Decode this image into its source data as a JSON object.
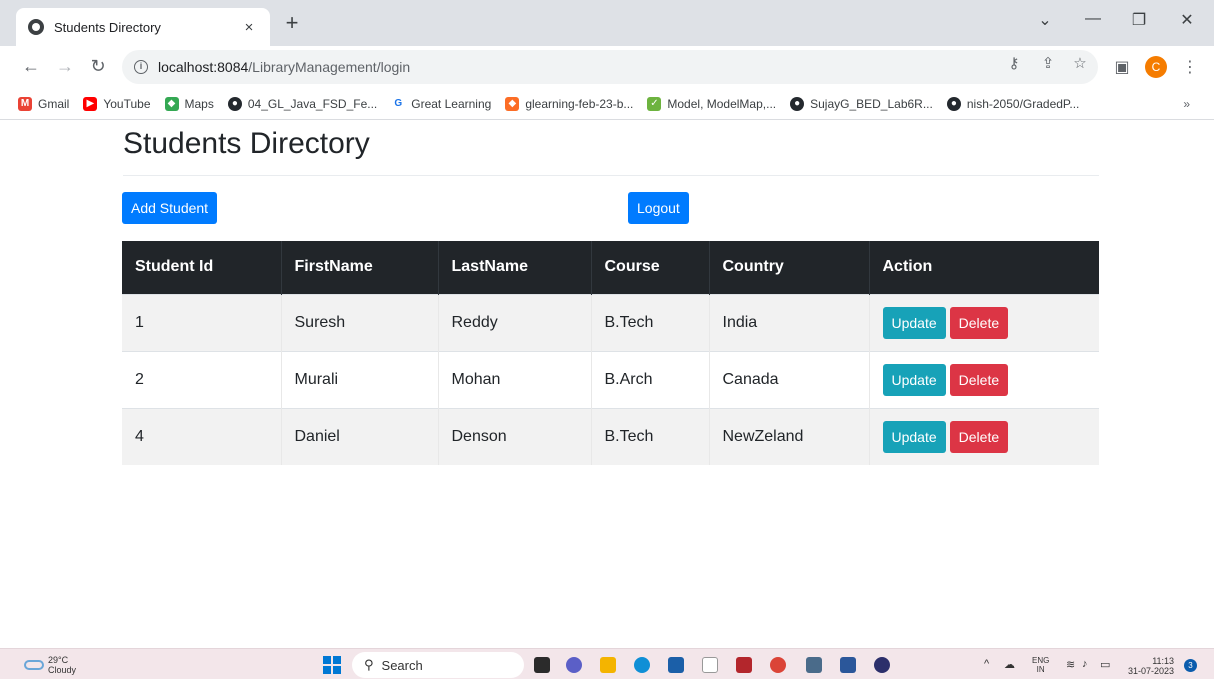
{
  "browser": {
    "tab_title": "Students Directory",
    "tab_close": "×",
    "new_tab": "+",
    "url_host": "localhost:8084",
    "url_path": "/LibraryManagement/login",
    "avatar_letter": "C",
    "bookmarks": [
      {
        "label": "Gmail",
        "icon": "gmail-icon",
        "color": "#ea4335"
      },
      {
        "label": "YouTube",
        "icon": "youtube-icon",
        "color": "#ff0000"
      },
      {
        "label": "Maps",
        "icon": "maps-icon",
        "color": "#34a853"
      },
      {
        "label": "04_GL_Java_FSD_Fe...",
        "icon": "github-icon",
        "color": "#24292e"
      },
      {
        "label": "Great Learning",
        "icon": "great-learning-icon",
        "color": "#1a73e8"
      },
      {
        "label": "glearning-feb-23-b...",
        "icon": "gitlab-icon",
        "color": "#fc6d26"
      },
      {
        "label": "Model, ModelMap,...",
        "icon": "spring-icon",
        "color": "#6db33f"
      },
      {
        "label": "SujayG_BED_Lab6R...",
        "icon": "github-icon",
        "color": "#24292e"
      },
      {
        "label": "nish-2050/GradedP...",
        "icon": "github-icon",
        "color": "#24292e"
      }
    ],
    "bookmarks_more": "»"
  },
  "page": {
    "title": "Students Directory",
    "add_button": "Add Student",
    "logout_button": "Logout",
    "table": {
      "headers": [
        "Student Id",
        "FirstName",
        "LastName",
        "Course",
        "Country",
        "Action"
      ],
      "rows": [
        {
          "id": "1",
          "first": "Suresh",
          "last": "Reddy",
          "course": "B.Tech",
          "country": "India"
        },
        {
          "id": "2",
          "first": "Murali",
          "last": "Mohan",
          "course": "B.Arch",
          "country": "Canada"
        },
        {
          "id": "4",
          "first": "Daniel",
          "last": "Denson",
          "course": "B.Tech",
          "country": "NewZeland"
        }
      ],
      "update_label": "Update",
      "delete_label": "Delete"
    }
  },
  "taskbar": {
    "temperature": "29°C",
    "weather": "Cloudy",
    "search_label": "Search",
    "lang_top": "ENG",
    "lang_bottom": "IN",
    "time": "11:13",
    "date": "31-07-2023",
    "notification_count": "3"
  },
  "colors": {
    "primary": "#007bff",
    "info": "#17a2b8",
    "danger": "#dc3545",
    "table_header": "#212529"
  }
}
